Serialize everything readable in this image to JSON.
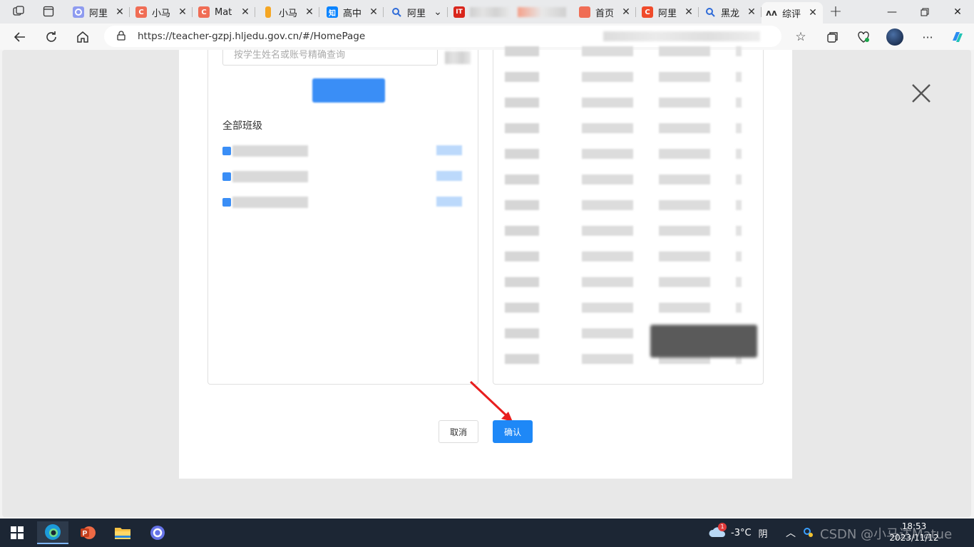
{
  "tabs": [
    {
      "title": "阿里",
      "color": "#8e9bf0",
      "glyph": ""
    },
    {
      "title": "小马",
      "color": "#f06d55",
      "glyph": "C"
    },
    {
      "title": "Mat",
      "color": "#f06d55",
      "glyph": "C"
    },
    {
      "title": "小马",
      "color": "#f5a623",
      "glyph": ""
    },
    {
      "title": "高中",
      "color": "#0b84ff",
      "glyph": "知"
    },
    {
      "title": "阿里",
      "color": "#2f6bd8",
      "glyph": ""
    },
    {
      "title": "",
      "color": "#d9261c",
      "glyph": "IT"
    },
    {
      "title": "",
      "color": "#e0e0e0",
      "glyph": ""
    },
    {
      "title": "首页",
      "color": "#f06d55",
      "glyph": ""
    },
    {
      "title": "阿里",
      "color": "#f04b2b",
      "glyph": "C"
    },
    {
      "title": "黑龙",
      "color": "#2f6bd8",
      "glyph": ""
    },
    {
      "title": "综评",
      "color": "#333333",
      "glyph": ""
    }
  ],
  "address": {
    "url": "https://teacher-gzpj.hljedu.gov.cn/#/HomePage"
  },
  "dialog": {
    "search_placeholder": "按学生姓名或账号精确查询",
    "all_classes_label": "全部班级",
    "class_rows": [
      "",
      "",
      ""
    ],
    "cancel_label": "取消",
    "confirm_label": "确认"
  },
  "taskbar": {
    "weather_badge": "1",
    "temperature": "-3°C",
    "weather": "阴",
    "time": "18:53",
    "date": "2023/11/12",
    "watermark": "CSDN @小马达Matue"
  },
  "colors": {
    "accent": "#1e88f7",
    "taskbar": "#1c2634"
  }
}
